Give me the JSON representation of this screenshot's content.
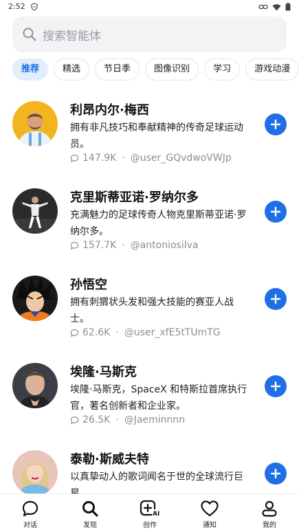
{
  "status_bar": {
    "time": "2:52"
  },
  "search": {
    "placeholder": "搜索智能体"
  },
  "categories": [
    {
      "label": "推荐",
      "active": true
    },
    {
      "label": "精选"
    },
    {
      "label": "节日季"
    },
    {
      "label": "图像识别"
    },
    {
      "label": "学习"
    },
    {
      "label": "游戏动漫"
    }
  ],
  "agents": [
    {
      "name": "利昂内尔·梅西",
      "description": "拥有非凡技巧和奉献精神的传奇足球运动员。",
      "comments": "147.9K",
      "author": "@user_GQvdwoVWJp"
    },
    {
      "name": "克里斯蒂亚诺·罗纳尔多",
      "description": "充满魅力的足球传奇人物克里斯蒂亚诺·罗纳尔多。",
      "comments": "157.7K",
      "author": "@antoniosilva"
    },
    {
      "name": "孙悟空",
      "description": "拥有刺猬状头发和强大技能的赛亚人战士。",
      "comments": "62.6K",
      "author": "@user_xfE5tTUmTG"
    },
    {
      "name": "埃隆·马斯克",
      "description": "埃隆·马斯克，SpaceX 和特斯拉首席执行官，著名创新者和企业家。",
      "comments": "26.5K",
      "author": "@Jaeminnnn"
    },
    {
      "name": "泰勒·斯威夫特",
      "description": "以真挚动人的歌词闻名于世的全球流行巨星。",
      "comments": "",
      "author": ""
    }
  ],
  "tabbar": [
    {
      "label": "对话",
      "icon": "chat-icon"
    },
    {
      "label": "发现",
      "icon": "search-icon"
    },
    {
      "label": "创作",
      "icon": "create-ai-icon"
    },
    {
      "label": "通知",
      "icon": "heart-icon"
    },
    {
      "label": "我的",
      "icon": "person-icon"
    }
  ],
  "colors": {
    "accent": "#1f6fe6",
    "chip_active_bg": "#e3eefc",
    "muted": "#8a8d93"
  }
}
